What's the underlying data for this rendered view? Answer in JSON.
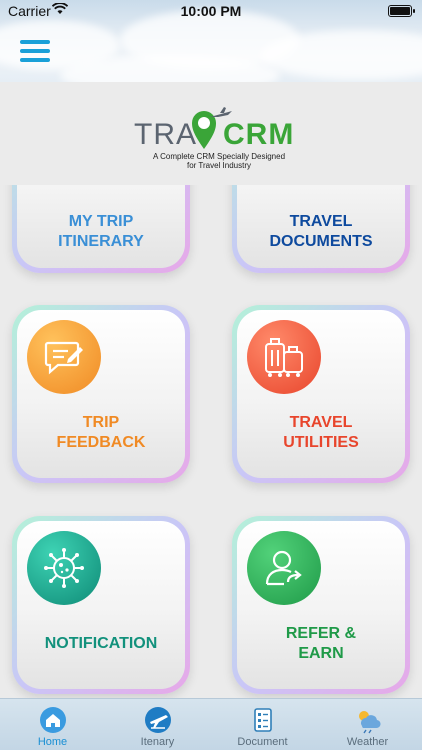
{
  "status_bar": {
    "carrier": "Carrier",
    "time": "10:00 PM"
  },
  "logo": {
    "part1": "TRA",
    "part2": "CRM",
    "tagline_line1": "A Complete CRM Specially Designed",
    "tagline_line2": "for Travel Industry",
    "brand_colors": {
      "grey": "#5b6470",
      "green": "#3aa538"
    }
  },
  "tiles": [
    {
      "label_line1": "MY TRIP",
      "label_line2": "ITINERARY",
      "color": "#3a8fd6",
      "icon": "itinerary-icon"
    },
    {
      "label_line1": "TRAVEL",
      "label_line2": "DOCUMENTS",
      "color": "#0e4a9e",
      "icon": "documents-icon"
    },
    {
      "label_line1": "TRIP",
      "label_line2": "FEEDBACK",
      "color": "#f08a24",
      "icon": "feedback-icon"
    },
    {
      "label_line1": "TRAVEL",
      "label_line2": "UTILITIES",
      "color": "#e8452c",
      "icon": "luggage-icon"
    },
    {
      "label_line1": "NOTIFICATION",
      "label_line2": "",
      "color": "#12917c",
      "icon": "virus-icon"
    },
    {
      "label_line1": "REFER &",
      "label_line2": "EARN",
      "color": "#1f9a48",
      "icon": "refer-user-icon"
    }
  ],
  "tabs": [
    {
      "label": "Home",
      "icon": "home-icon",
      "active": true
    },
    {
      "label": "Itenary",
      "icon": "plane-icon",
      "active": false
    },
    {
      "label": "Document",
      "icon": "document-icon",
      "active": false
    },
    {
      "label": "Weather",
      "icon": "weather-icon",
      "active": false
    }
  ]
}
